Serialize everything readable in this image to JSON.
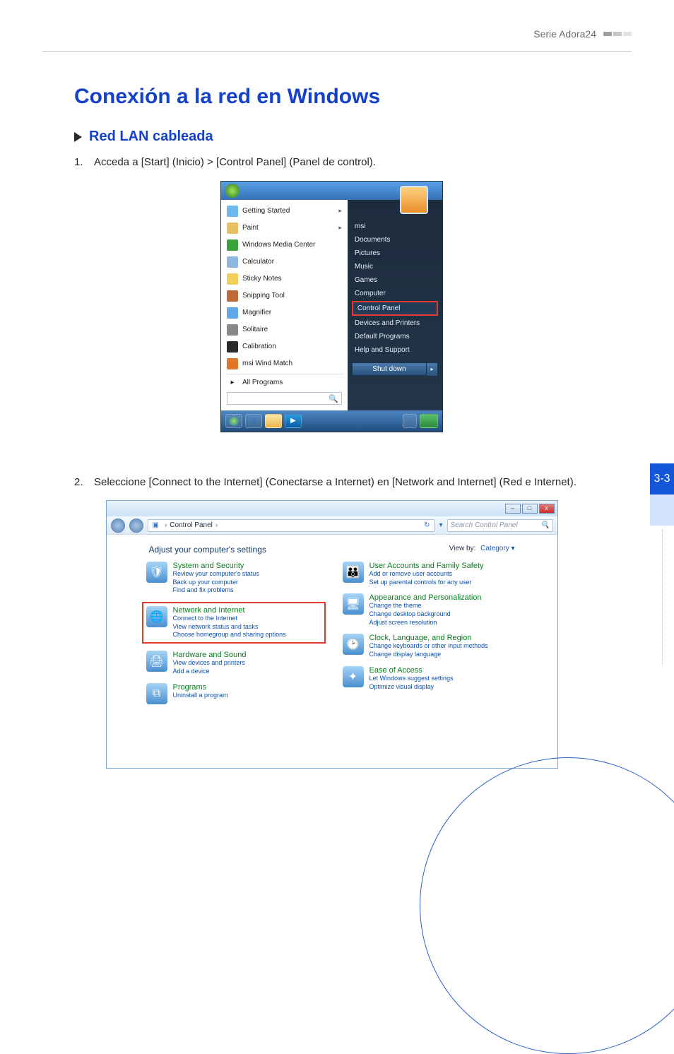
{
  "header": {
    "series": "Serie Adora24"
  },
  "title": "Conexión a la red en Windows",
  "subhead": "Red LAN cableada",
  "steps": {
    "s1": {
      "num": "1.",
      "text": "Acceda a [Start] (Inicio) > [Control Panel] (Panel de control)."
    },
    "s2": {
      "num": "2.",
      "text": "Seleccione [Connect to the Internet] (Conectarse a Internet) en [Network and Internet] (Red e Internet)."
    }
  },
  "start_menu": {
    "left_items": [
      {
        "label": "Getting Started",
        "has_arrow": true,
        "color": "#6fb8ef"
      },
      {
        "label": "Paint",
        "has_arrow": true,
        "color": "#e8c060"
      },
      {
        "label": "Windows Media Center",
        "has_arrow": false,
        "color": "#3aa23a"
      },
      {
        "label": "Calculator",
        "has_arrow": false,
        "color": "#8fb8e0"
      },
      {
        "label": "Sticky Notes",
        "has_arrow": false,
        "color": "#f2cf5a"
      },
      {
        "label": "Snipping Tool",
        "has_arrow": false,
        "color": "#c06838"
      },
      {
        "label": "Magnifier",
        "has_arrow": false,
        "color": "#5fa7e6"
      },
      {
        "label": "Solitaire",
        "has_arrow": false,
        "color": "#888"
      },
      {
        "label": "Calibration",
        "has_arrow": false,
        "color": "#2a2a2a"
      },
      {
        "label": "msi Wind Match",
        "has_arrow": false,
        "color": "#e0762a"
      }
    ],
    "all_programs": "All Programs",
    "right_items_top": [
      "msi",
      "Documents",
      "Pictures",
      "Music",
      "Games",
      "Computer"
    ],
    "right_hi": "Control Panel",
    "right_items_bottom": [
      "Devices and Printers",
      "Default Programs",
      "Help and Support"
    ],
    "shutdown": "Shut down"
  },
  "control_panel": {
    "crumb_root": "Control Panel",
    "search_placeholder": "Search Control Panel",
    "adjust": "Adjust your computer's settings",
    "view_by_label": "View by:",
    "view_by_value": "Category ▾",
    "left": [
      {
        "title": "System and Security",
        "links": [
          "Review your computer's status",
          "Back up your computer",
          "Find and fix problems"
        ],
        "glyph": "🛡",
        "hi": false
      },
      {
        "title": "Network and Internet",
        "links": [
          "Connect to the Internet",
          "View network status and tasks",
          "Choose homegroup and sharing options"
        ],
        "glyph": "🌐",
        "hi": true
      },
      {
        "title": "Hardware and Sound",
        "links": [
          "View devices and printers",
          "Add a device"
        ],
        "glyph": "🖨",
        "hi": false
      },
      {
        "title": "Programs",
        "links": [
          "Uninstall a program"
        ],
        "glyph": "⧉",
        "hi": false
      }
    ],
    "right": [
      {
        "title": "User Accounts and Family Safety",
        "links": [
          "Add or remove user accounts",
          "Set up parental controls for any user"
        ],
        "glyph": "👪"
      },
      {
        "title": "Appearance and Personalization",
        "links": [
          "Change the theme",
          "Change desktop background",
          "Adjust screen resolution"
        ],
        "glyph": "🖥"
      },
      {
        "title": "Clock, Language, and Region",
        "links": [
          "Change keyboards or other input methods",
          "Change display language"
        ],
        "glyph": "🕑"
      },
      {
        "title": "Ease of Access",
        "links": [
          "Let Windows suggest settings",
          "Optimize visual display"
        ],
        "glyph": "✦"
      }
    ]
  },
  "page_tab": "3-3"
}
